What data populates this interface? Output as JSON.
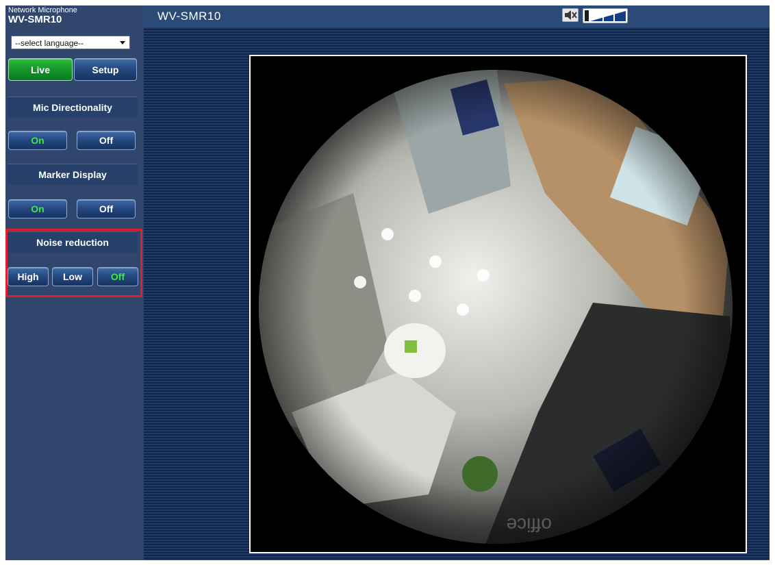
{
  "device": {
    "type": "Network Microphone",
    "model": "WV-SMR10"
  },
  "header": {
    "title": "WV-SMR10"
  },
  "language": {
    "selected": "--select language--"
  },
  "nav": {
    "live_label": "Live",
    "setup_label": "Setup"
  },
  "sections": {
    "mic_directionality": {
      "title": "Mic Directionality",
      "on_label": "On",
      "off_label": "Off"
    },
    "marker_display": {
      "title": "Marker Display",
      "on_label": "On",
      "off_label": "Off"
    },
    "noise_reduction": {
      "title": "Noise reduction",
      "high_label": "High",
      "low_label": "Low",
      "off_label": "Off"
    }
  },
  "video": {
    "overlay_text": "office"
  },
  "colors": {
    "sidebar_bg": "#30466d",
    "button_blue": "#24477e",
    "button_green": "#14952a",
    "active_text_green": "#3dea3d",
    "highlight_red": "#e0202a"
  },
  "icons": {
    "mute": "speaker-mute-icon",
    "volume": "volume-level-icon",
    "dropdown": "chevron-down-icon"
  }
}
